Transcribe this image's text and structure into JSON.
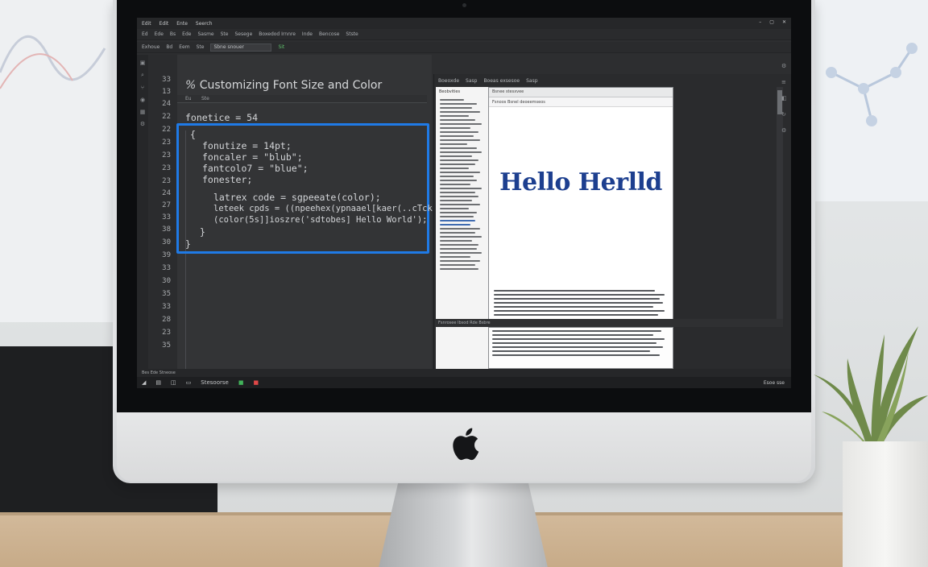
{
  "menubar": {
    "items": [
      "Edit",
      "Edit",
      "Ente",
      "Seerch"
    ],
    "window_controls": [
      "–",
      "▢",
      "✕"
    ]
  },
  "toolbar1": {
    "items": [
      "Ed",
      "Ede",
      "Bs",
      "Ede",
      "Sasme",
      "Ste",
      "Sesege",
      "Boxedod Irnnre",
      "Inde",
      "Bencose",
      "Stste"
    ]
  },
  "toolbar2": {
    "items": [
      "Exhoue",
      "Bd",
      "Eem",
      "Ste"
    ],
    "field_value": "Sbne snouer",
    "green_label": "Sit"
  },
  "gutter": {
    "line_numbers": [
      "33",
      "13",
      "24",
      "22",
      "22",
      "23",
      "23",
      "23",
      "23",
      "24",
      "27",
      "33",
      "38",
      "30",
      "39",
      "33",
      "30",
      "35",
      "33",
      "28",
      "23",
      "35"
    ]
  },
  "editor": {
    "title_prefix": "%",
    "title": "Customizing Font Size and Color",
    "tabs": [
      "Eu",
      "Ste"
    ],
    "code_lines": [
      "fonetice = 54",
      "fonutize = 14pt;",
      "foncaler = \"blub\";",
      "fantcolo7 = \"blue\";",
      "fonester;",
      "latrex code = sgpeeate(color);",
      "leteek cpds = ((npeehex(ypnaael[kaer(..cTck",
      "(color(5s]]ioszre('sdtobes] Hello World');"
    ],
    "braces": [
      "{",
      "}",
      "}"
    ]
  },
  "right_pane": {
    "header_items": [
      "Boeoxde",
      "Sasp",
      "Boeas exsesoe",
      "Sasp"
    ],
    "outline_heading": "Beobvities",
    "preview_title": "Bsnee stesxvee",
    "preview_toolbar": "Fsnoos Bsnel deoeemseos",
    "preview_heading": "Hello Herlld",
    "bottom_bar": "Fsnrosee Ibsod Rde Bsbre"
  },
  "statusbar": {
    "text": "Bes Ede Stneose"
  },
  "taskbar": {
    "text": "Stesoorse",
    "clock": "Esoe sse"
  },
  "colors": {
    "highlight": "#1f7ae6",
    "preview_heading": "#1d3f8f",
    "screen_bg": "#2d2e30"
  }
}
